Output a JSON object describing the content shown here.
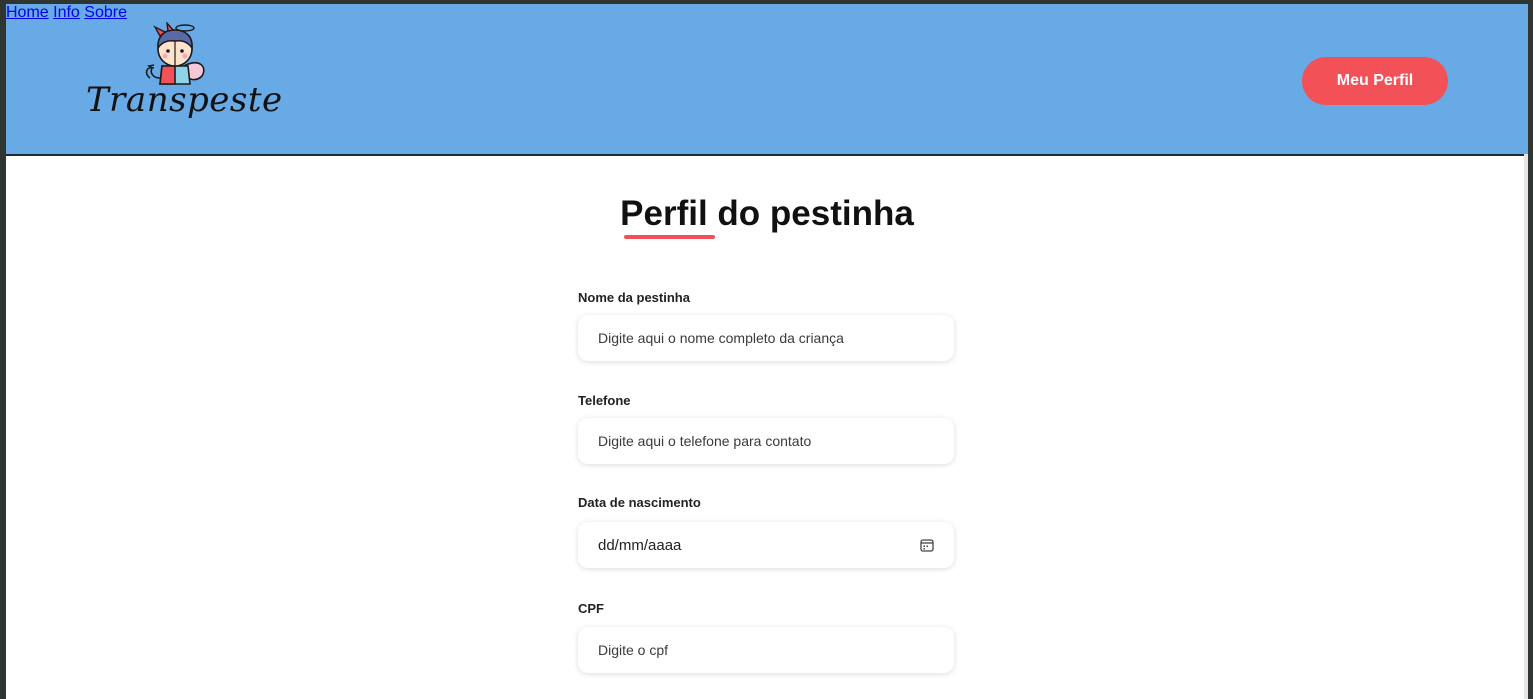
{
  "brand": {
    "name": "Transpeste"
  },
  "nav": {
    "items": [
      {
        "label": "Home"
      },
      {
        "label": "Info"
      },
      {
        "label": "Sobre"
      }
    ],
    "profile_label": "Meu Perfil"
  },
  "page": {
    "title": "Perfil do pestinha",
    "accent_color": "#f25157",
    "header_color": "#67aae5"
  },
  "form": {
    "name": {
      "label": "Nome da pestinha",
      "placeholder": "Digite aqui o nome completo da criança"
    },
    "phone": {
      "label": "Telefone",
      "placeholder": "Digite aqui o telefone para contato"
    },
    "birthdate": {
      "label": "Data de nascimento",
      "value": "dd/mm/aaaa",
      "icon": "calendar-icon"
    },
    "cpf": {
      "label": "CPF",
      "placeholder": "Digite o cpf"
    }
  }
}
